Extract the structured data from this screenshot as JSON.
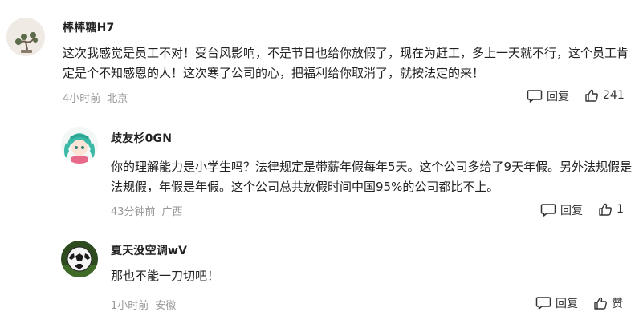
{
  "comments": [
    {
      "username": "棒棒糖H7",
      "text": "这次我感觉是员工不对！受台风影响，不是节日也给你放假了，现在为赶工，多上一天就不行，这个员工肯定是个不知感恩的人！这次寒了公司的心，把福利给你取消了，就按法定的来！",
      "time": "4小时前",
      "location": "北京",
      "reply_label": "回复",
      "like_label": "241"
    },
    {
      "username": "歧友杉0GN",
      "text": "你的理解能力是小学生吗？法律规定是带薪年假每年5天。这个公司多给了9天年假。另外法规假是法规假，年假是年假。这个公司总共放假时间中国95%的公司都比不上。",
      "time": "43分钟前",
      "location": "广西",
      "reply_label": "回复",
      "like_label": "1"
    },
    {
      "username": "夏天没空调wV",
      "text": "那也不能一刀切吧！",
      "time": "1小时前",
      "location": "安徽",
      "reply_label": "回复",
      "like_label": "赞"
    }
  ]
}
